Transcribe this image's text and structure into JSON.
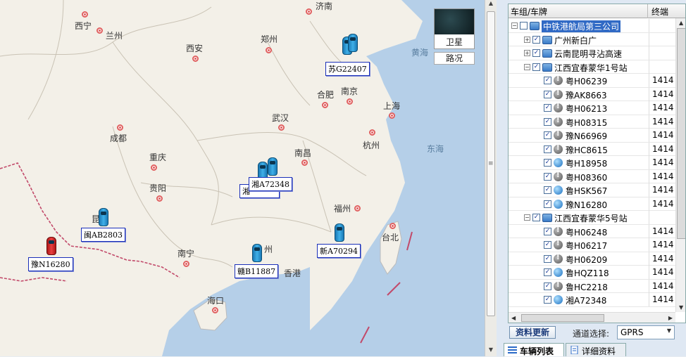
{
  "map": {
    "layer_switch": {
      "satellite": "卫星",
      "road": "路况"
    },
    "seas": [
      "黄海",
      "东海"
    ],
    "cities": [
      {
        "name": "西宁",
        "dot_side": "right"
      },
      {
        "name": "兰州",
        "dot_side": "left"
      },
      {
        "name": "济南",
        "dot_side": "left"
      },
      {
        "name": "西安",
        "dot_side": "below"
      },
      {
        "name": "郑州",
        "dot_side": "below"
      },
      {
        "name": "合肥",
        "dot_side": "below"
      },
      {
        "name": "南京",
        "dot_side": "below"
      },
      {
        "name": "武汉",
        "dot_side": "below"
      },
      {
        "name": "上海",
        "dot_side": "below"
      },
      {
        "name": "成都",
        "dot_side": "above"
      },
      {
        "name": "杭州",
        "dot_side": "above"
      },
      {
        "name": "重庆",
        "dot_side": "below"
      },
      {
        "name": "南昌",
        "dot_side": "below"
      },
      {
        "name": "贵阳",
        "dot_side": "below"
      },
      {
        "name": "福州",
        "dot_side": "right"
      },
      {
        "name": "台北",
        "dot_side": "above"
      },
      {
        "name": "南宁",
        "dot_side": "below"
      },
      {
        "name": "香港",
        "dot_side": "none"
      },
      {
        "name": "海口",
        "dot_side": "below"
      },
      {
        "name": "昆",
        "dot_side": "none"
      },
      {
        "name": "州",
        "dot_side": "none"
      }
    ],
    "vehicles": [
      {
        "plate": "苏G22407",
        "color": "blue"
      },
      {
        "plate": "湘A72348",
        "color": "blue"
      },
      {
        "plate": "湘",
        "color": "blue"
      },
      {
        "plate": "闽AB2803",
        "color": "blue"
      },
      {
        "plate": "豫N16280",
        "color": "red"
      },
      {
        "plate": "赣B11887",
        "color": "blue"
      },
      {
        "plate": "新A70294",
        "color": "blue"
      }
    ]
  },
  "tree": {
    "headers": {
      "col1": "车组/车牌",
      "col2": "终端"
    },
    "rows": [
      {
        "level": 0,
        "type": "group",
        "label": "中铁港航局第三公司",
        "toggle": "−",
        "checked": false,
        "selected": true,
        "col2": ""
      },
      {
        "level": 1,
        "type": "group",
        "label": "广州新白广",
        "toggle": "+",
        "checked": true,
        "col2": ""
      },
      {
        "level": 1,
        "type": "group",
        "label": "云南昆明寻沾高速",
        "toggle": "+",
        "checked": true,
        "col2": ""
      },
      {
        "level": 1,
        "type": "group",
        "label": "江西宜春蒙华1号站",
        "toggle": "−",
        "checked": true,
        "col2": ""
      },
      {
        "level": 2,
        "type": "vehicle",
        "icon": "grey",
        "label": "粤H06239",
        "checked": true,
        "col2": "1414"
      },
      {
        "level": 2,
        "type": "vehicle",
        "icon": "grey",
        "label": "豫AK8663",
        "checked": true,
        "col2": "1414"
      },
      {
        "level": 2,
        "type": "vehicle",
        "icon": "grey",
        "label": "粤H06213",
        "checked": true,
        "col2": "1414"
      },
      {
        "level": 2,
        "type": "vehicle",
        "icon": "grey",
        "label": "粤H08315",
        "checked": true,
        "col2": "1414"
      },
      {
        "level": 2,
        "type": "vehicle",
        "icon": "grey",
        "label": "豫N66969",
        "checked": true,
        "col2": "1414"
      },
      {
        "level": 2,
        "type": "vehicle",
        "icon": "grey",
        "label": "豫HC8615",
        "checked": true,
        "col2": "1414"
      },
      {
        "level": 2,
        "type": "vehicle",
        "icon": "globe",
        "label": "粤H18958",
        "checked": true,
        "col2": "1414"
      },
      {
        "level": 2,
        "type": "vehicle",
        "icon": "grey",
        "label": "粤H08360",
        "checked": true,
        "col2": "1414"
      },
      {
        "level": 2,
        "type": "vehicle",
        "icon": "globe",
        "label": "鲁HSK567",
        "checked": true,
        "col2": "1414"
      },
      {
        "level": 2,
        "type": "vehicle",
        "icon": "globe",
        "label": "豫N16280",
        "checked": true,
        "col2": "1414"
      },
      {
        "level": 1,
        "type": "group",
        "label": "江西宜春蒙华5号站",
        "toggle": "−",
        "checked": true,
        "col2": ""
      },
      {
        "level": 2,
        "type": "vehicle",
        "icon": "grey",
        "label": "粤H06248",
        "checked": true,
        "col2": "1414"
      },
      {
        "level": 2,
        "type": "vehicle",
        "icon": "grey",
        "label": "粤H06217",
        "checked": true,
        "col2": "1414"
      },
      {
        "level": 2,
        "type": "vehicle",
        "icon": "grey",
        "label": "粤H06209",
        "checked": true,
        "col2": "1414"
      },
      {
        "level": 2,
        "type": "vehicle",
        "icon": "globe",
        "label": "鲁HQZ118",
        "checked": true,
        "col2": "1414"
      },
      {
        "level": 2,
        "type": "vehicle",
        "icon": "grey",
        "label": "鲁HC2218",
        "checked": true,
        "col2": "1414"
      },
      {
        "level": 2,
        "type": "vehicle",
        "icon": "globe",
        "label": "湘A72348",
        "checked": true,
        "col2": "1414"
      }
    ]
  },
  "controls": {
    "update_button": "资料更新",
    "channel_label": "通道选择:",
    "channel_value": "GPRS"
  },
  "tabs": [
    {
      "label": "车辆列表",
      "active": true
    },
    {
      "label": "详细资料",
      "active": false
    }
  ]
}
